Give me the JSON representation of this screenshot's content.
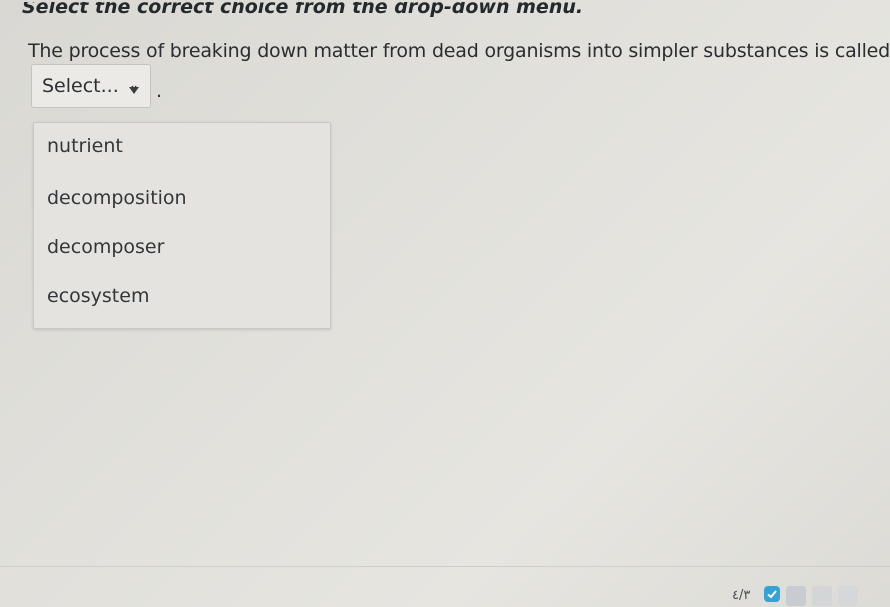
{
  "instruction": "Select the correct choice from the drop-down menu.",
  "question": "The process of breaking down matter from dead organisms into simpler substances is called",
  "select": {
    "placeholder": "Select...",
    "trailing_text": "."
  },
  "dropdown": {
    "options": [
      "nutrient",
      "decomposition",
      "decomposer",
      "ecosystem"
    ]
  },
  "footer": {
    "page_indicator": "٤/٣",
    "check_icon": "check-icon"
  },
  "colors": {
    "accent": "#36a3d6",
    "background": "#e1e0db"
  }
}
